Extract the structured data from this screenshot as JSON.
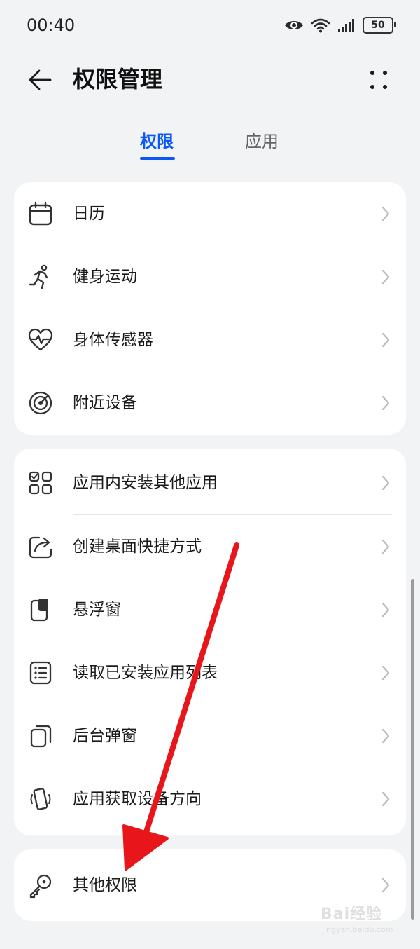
{
  "status": {
    "time": "00:40",
    "battery": "50",
    "icons": [
      "eye-icon",
      "wifi-icon",
      "signal-icon",
      "battery-icon"
    ]
  },
  "header": {
    "title": "权限管理",
    "back_icon": "arrow-left-icon",
    "more_icon": "more-icon"
  },
  "tabs": [
    {
      "label": "权限",
      "active": true
    },
    {
      "label": "应用",
      "active": false
    }
  ],
  "groups": [
    {
      "items": [
        {
          "label": "日历",
          "icon": "calendar-icon"
        },
        {
          "label": "健身运动",
          "icon": "running-icon"
        },
        {
          "label": "身体传感器",
          "icon": "heartbeat-icon"
        },
        {
          "label": "附近设备",
          "icon": "radar-icon"
        }
      ]
    },
    {
      "items": [
        {
          "label": "应用内安装其他应用",
          "icon": "app-grid-icon"
        },
        {
          "label": "创建桌面快捷方式",
          "icon": "shortcut-icon"
        },
        {
          "label": "悬浮窗",
          "icon": "floating-window-icon"
        },
        {
          "label": "读取已安装应用列表",
          "icon": "list-icon"
        },
        {
          "label": "后台弹窗",
          "icon": "background-popup-icon"
        },
        {
          "label": "应用获取设备方向",
          "icon": "device-orientation-icon"
        }
      ]
    },
    {
      "items": [
        {
          "label": "其他权限",
          "icon": "key-icon"
        }
      ]
    }
  ],
  "colors": {
    "accent": "#0a59f7",
    "background": "#f1f3f5",
    "card": "#ffffff",
    "annotation": "#e8161b"
  },
  "watermark": {
    "brand": "Bai经验",
    "domain": "jingyan.baidu.com"
  }
}
